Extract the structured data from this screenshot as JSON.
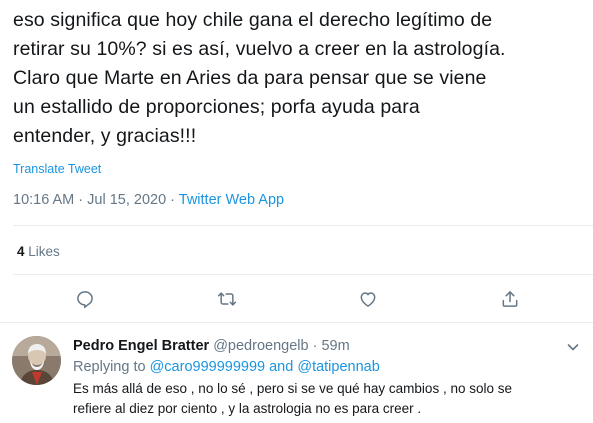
{
  "tweet": {
    "text_lines": [
      "eso significa que hoy chile gana el derecho legítimo de",
      "retirar su 10%? si es así, vuelvo a creer en la astrología.",
      "Claro que Marte en Aries da para pensar que se viene",
      "un estallido de proporciones; porfa ayuda para",
      "entender, y gracias!!!"
    ],
    "translate_label": "Translate Tweet",
    "timestamp": "10:16 AM · Jul 15, 2020",
    "separator": " · ",
    "source": "Twitter Web App",
    "likes_count": "4",
    "likes_label": "Likes"
  },
  "actions": {
    "icons": [
      "reply-icon",
      "retweet-icon",
      "like-icon",
      "share-icon"
    ]
  },
  "reply": {
    "name": "Pedro Engel Bratter",
    "handle": "@pedroengelb",
    "time_sep": " · ",
    "time": "59m",
    "replying_prefix": "Replying to ",
    "mention_1": "@caro999999999",
    "and_word": " and ",
    "mention_2": "@tatipennab",
    "text_lines": [
      "Es más allá de eso , no lo sé , pero si se ve qué hay cambios , no solo se",
      "refiere al diez  por ciento , y la astrologia no es para creer ."
    ]
  },
  "colors": {
    "link": "#1b95e0",
    "secondary": "#657786",
    "divider": "#e6ecf0",
    "text": "#14171a"
  }
}
